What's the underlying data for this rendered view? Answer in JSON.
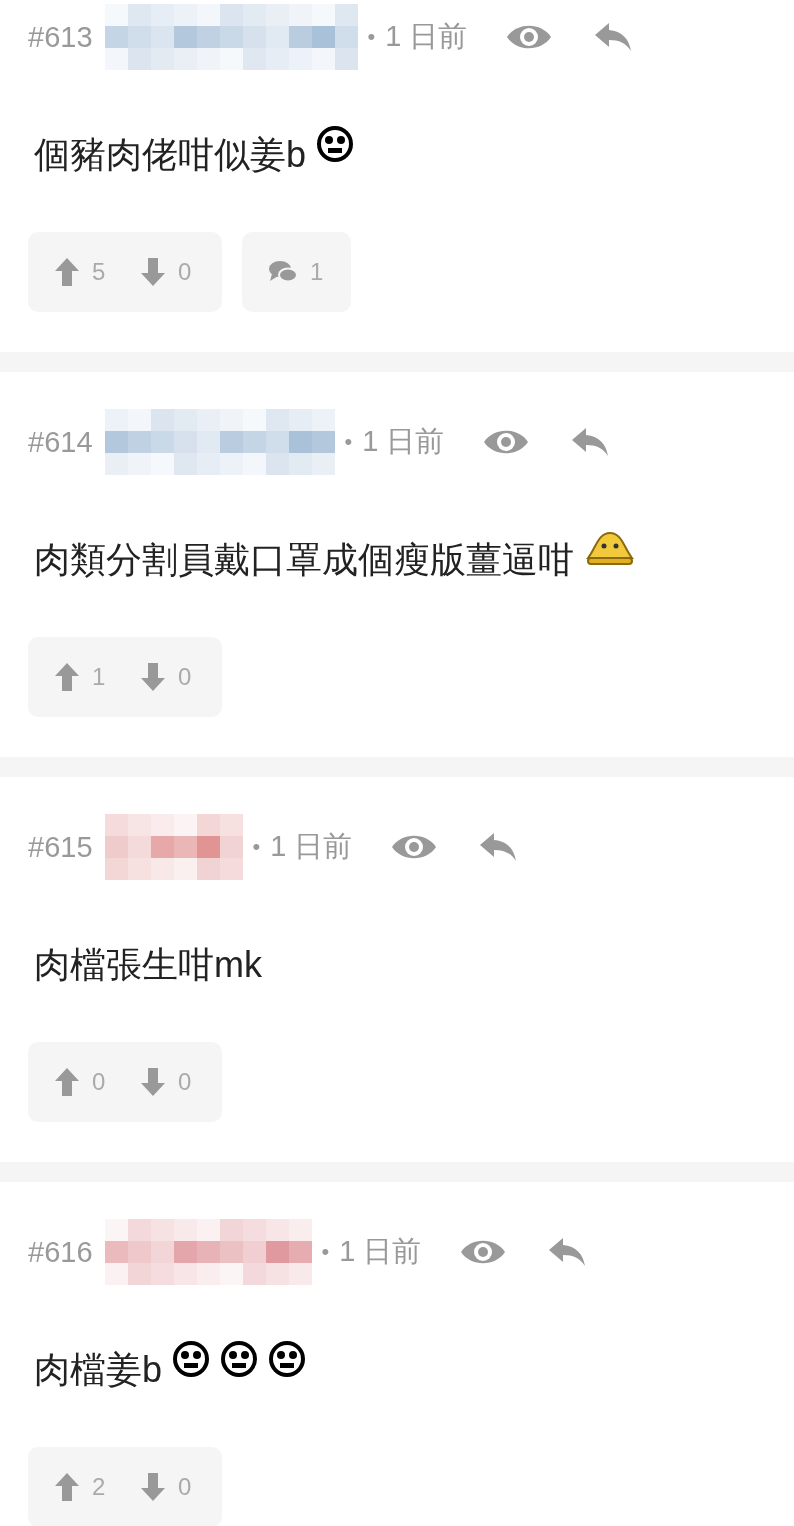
{
  "posts": [
    {
      "number": "#613",
      "color": "#a9c1d9",
      "dot": "•",
      "time": "1 日前",
      "body": [
        {
          "kind": "text",
          "text": "個豬肉佬咁似姜b"
        },
        {
          "kind": "face"
        }
      ],
      "up": "5",
      "down": "0",
      "comments": "1"
    },
    {
      "number": "#614",
      "color": "#a9c1d9",
      "dot": "•",
      "time": "1 日前",
      "body": [
        {
          "kind": "text",
          "text": "肉類分割員戴口罩成個瘦版薑逼咁"
        },
        {
          "kind": "bell"
        }
      ],
      "up": "1",
      "down": "0"
    },
    {
      "number": "#615",
      "color": "#e09494",
      "dot": "•",
      "time": "1 日前",
      "body": [
        {
          "kind": "text",
          "text": "肉檔張生咁mk"
        }
      ],
      "up": "0",
      "down": "0"
    },
    {
      "number": "#616",
      "color": "#e09a9f",
      "dot": "•",
      "time": "1 日前",
      "body": [
        {
          "kind": "text",
          "text": "肉檔姜b"
        },
        {
          "kind": "face"
        },
        {
          "kind": "face"
        },
        {
          "kind": "face"
        }
      ],
      "up": "2",
      "down": "0"
    }
  ]
}
